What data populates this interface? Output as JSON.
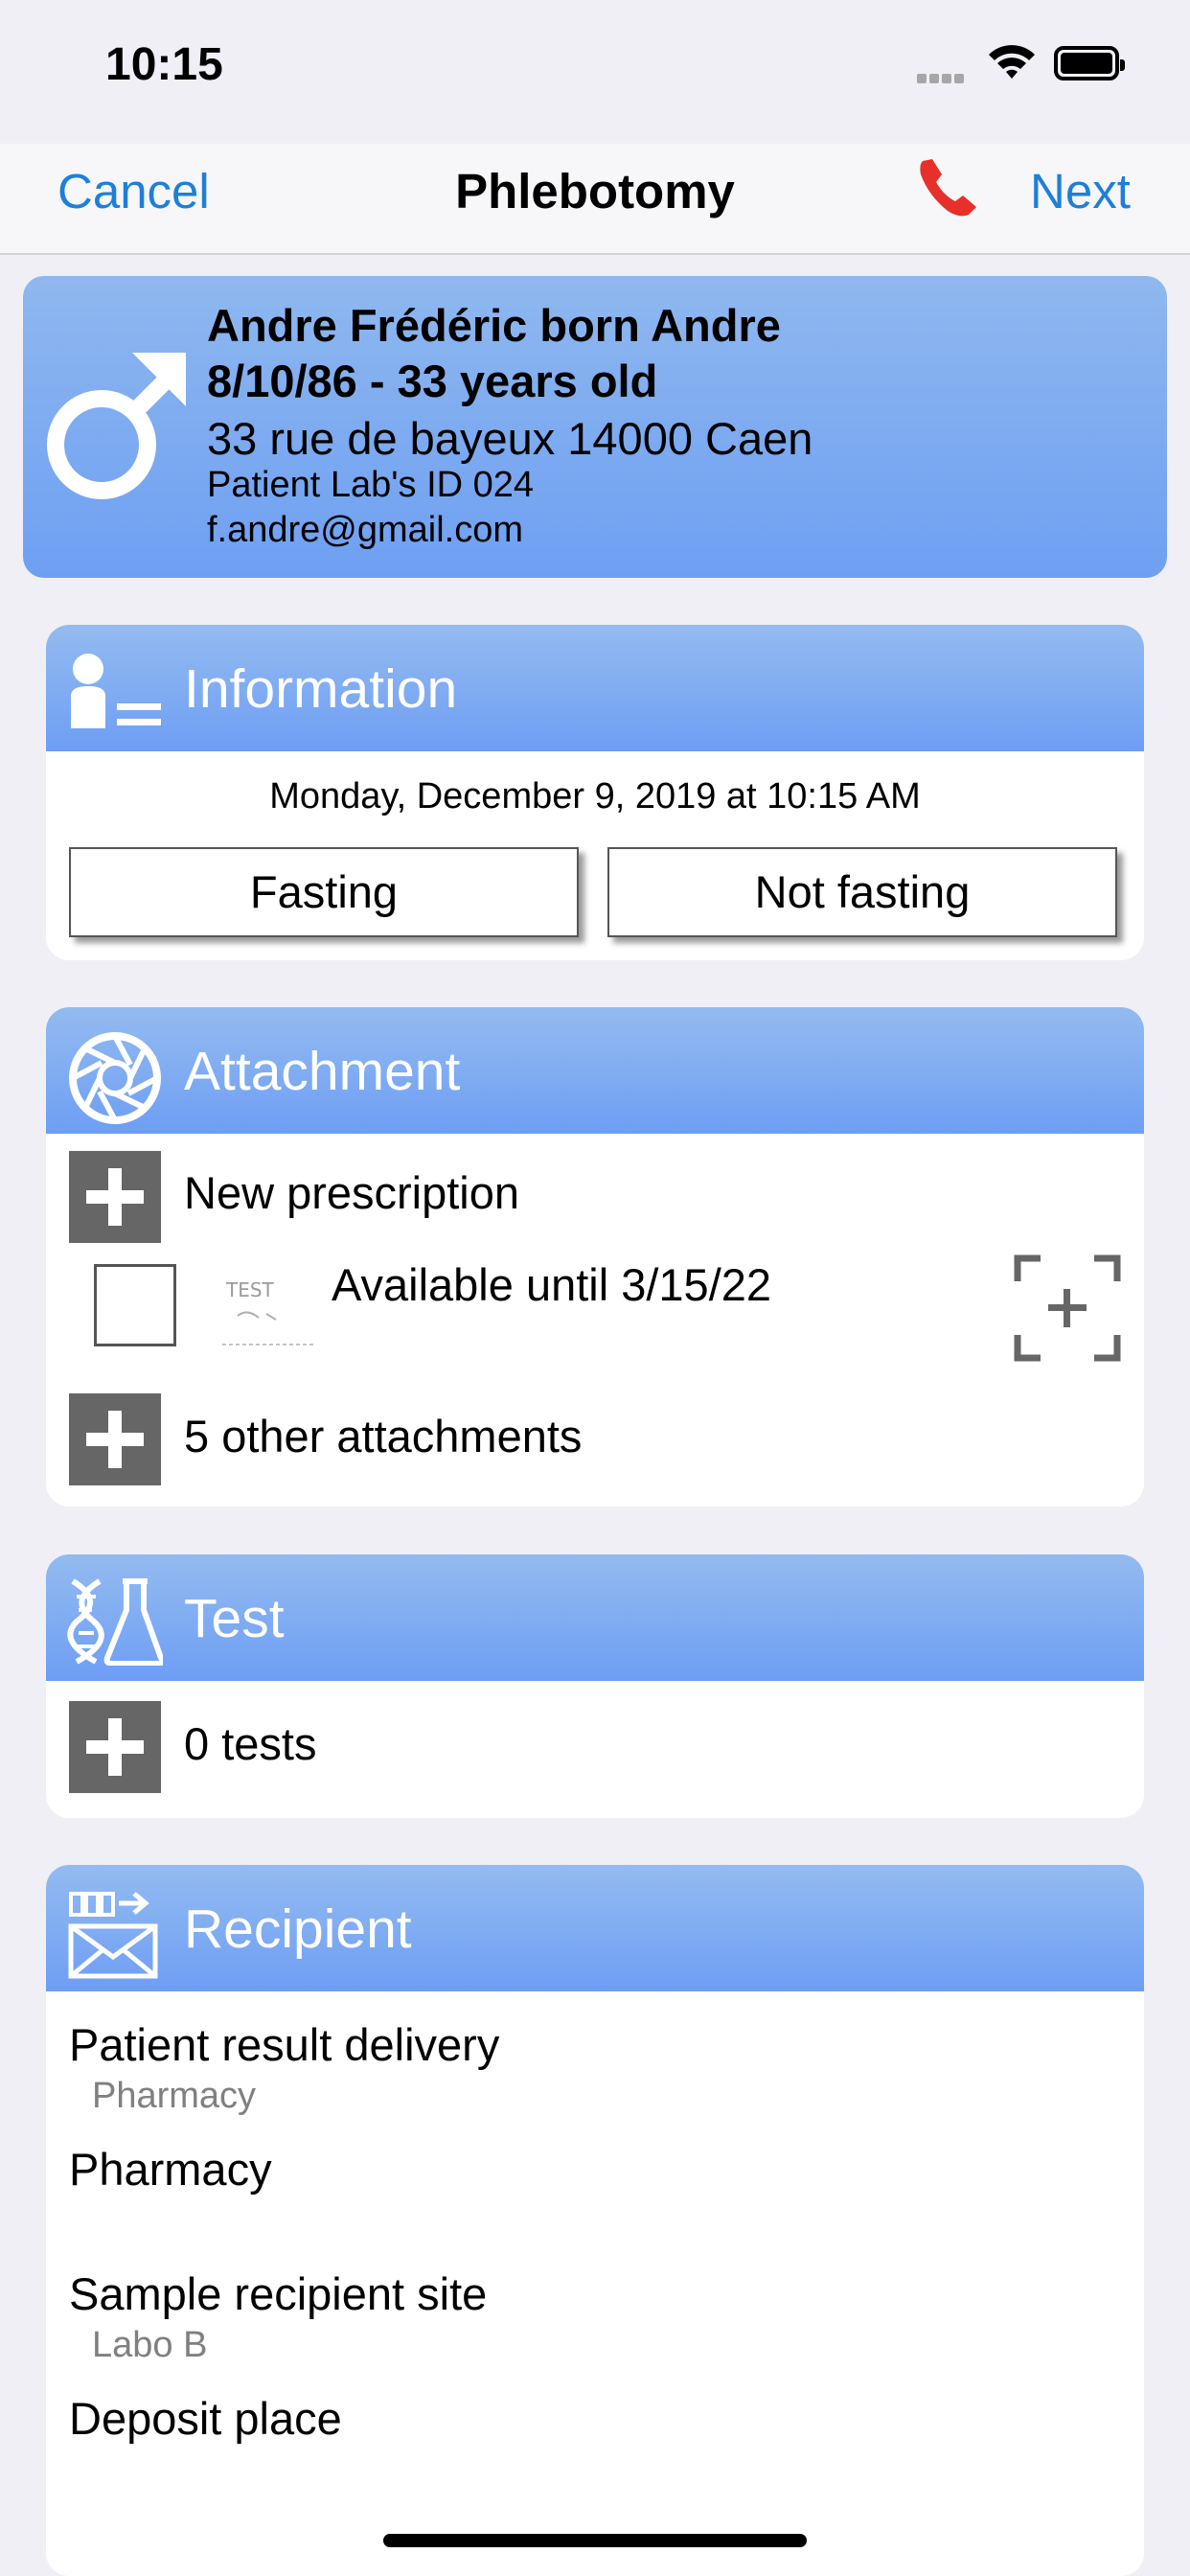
{
  "status_bar": {
    "time": "10:15"
  },
  "nav": {
    "cancel_label": "Cancel",
    "title": "Phlebotomy",
    "next_label": "Next"
  },
  "patient": {
    "name": "Andre Frédéric born Andre",
    "dob_age": "8/10/86 - 33 years old",
    "address": "33 rue de bayeux 14000 Caen",
    "lab_id": "Patient Lab's ID 024",
    "email": "f.andre@gmail.com"
  },
  "information": {
    "title": "Information",
    "datetime": "Monday, December 9, 2019 at 10:15 AM",
    "fasting_label": "Fasting",
    "not_fasting_label": "Not fasting"
  },
  "attachment": {
    "title": "Attachment",
    "new_prescription_label": "New prescription",
    "available_label": "Available until 3/15/22",
    "thumbnail_text": "TEST",
    "other_attachments_label": "5 other attachments"
  },
  "test": {
    "title": "Test",
    "count_label": "0 tests"
  },
  "recipient": {
    "title": "Recipient",
    "rows": [
      {
        "label": "Patient result delivery",
        "value": "Pharmacy"
      },
      {
        "label": "Pharmacy"
      },
      {
        "label": "Sample recipient site",
        "value": "Labo B"
      },
      {
        "label": "Deposit place"
      }
    ]
  },
  "colors": {
    "accent": "#1e7fd8",
    "header_gradient_top": "#93bbf0",
    "header_gradient_bottom": "#6e9ef4",
    "phone": "#e8302a"
  },
  "icons": [
    "phone-icon",
    "male-symbol-icon",
    "person-list-icon",
    "aperture-icon",
    "dna-flask-icon",
    "mail-send-icon",
    "plus-icon",
    "scan-add-icon"
  ]
}
